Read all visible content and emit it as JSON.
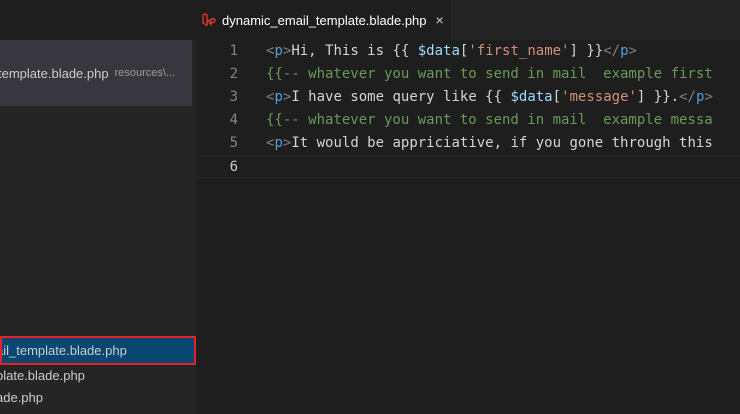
{
  "sidebar": {
    "open_editor": {
      "file_label": "template.blade.php",
      "path_label": "resources\\..."
    },
    "tree": [
      {
        "label": "ail_template.blade.php",
        "selected": true
      },
      {
        "label": "plate.blade.php",
        "selected": false
      },
      {
        "label": "ade.php",
        "selected": false
      }
    ]
  },
  "tab": {
    "title": "dynamic_email_template.blade.php",
    "close_glyph": "×",
    "icon": "laravel-icon"
  },
  "code": {
    "line_numbers": [
      "1",
      "2",
      "3",
      "4",
      "5",
      "6"
    ],
    "lines": [
      [
        {
          "t": "<",
          "c": "tg"
        },
        {
          "t": "p",
          "c": "tn"
        },
        {
          "t": ">",
          "c": "tg"
        },
        {
          "t": "Hi, This is {{ ",
          "c": "pl"
        },
        {
          "t": "$data",
          "c": "vr"
        },
        {
          "t": "[",
          "c": "pl"
        },
        {
          "t": "'first_name'",
          "c": "st"
        },
        {
          "t": "] }}",
          "c": "pl"
        },
        {
          "t": "</",
          "c": "tg"
        },
        {
          "t": "p",
          "c": "tn"
        },
        {
          "t": ">",
          "c": "tg"
        }
      ],
      [
        {
          "t": "{{-- whatever you want to send in mail  example first",
          "c": "cm"
        }
      ],
      [
        {
          "t": "<",
          "c": "tg"
        },
        {
          "t": "p",
          "c": "tn"
        },
        {
          "t": ">",
          "c": "tg"
        },
        {
          "t": "I have some query like {{ ",
          "c": "pl"
        },
        {
          "t": "$data",
          "c": "vr"
        },
        {
          "t": "[",
          "c": "pl"
        },
        {
          "t": "'message'",
          "c": "st"
        },
        {
          "t": "] }}.",
          "c": "pl"
        },
        {
          "t": "</",
          "c": "tg"
        },
        {
          "t": "p",
          "c": "tn"
        },
        {
          "t": ">",
          "c": "tg"
        }
      ],
      [
        {
          "t": "{{-- whatever you want to send in mail  example messa",
          "c": "cm"
        }
      ],
      [
        {
          "t": "<",
          "c": "tg"
        },
        {
          "t": "p",
          "c": "tn"
        },
        {
          "t": ">",
          "c": "tg"
        },
        {
          "t": "It would be appriciative, if you gone through this",
          "c": "pl"
        }
      ],
      []
    ]
  },
  "colors": {
    "selection_outline": "#e8202a",
    "selection_bg": "#094771",
    "laravel_icon": "#e3342f"
  }
}
